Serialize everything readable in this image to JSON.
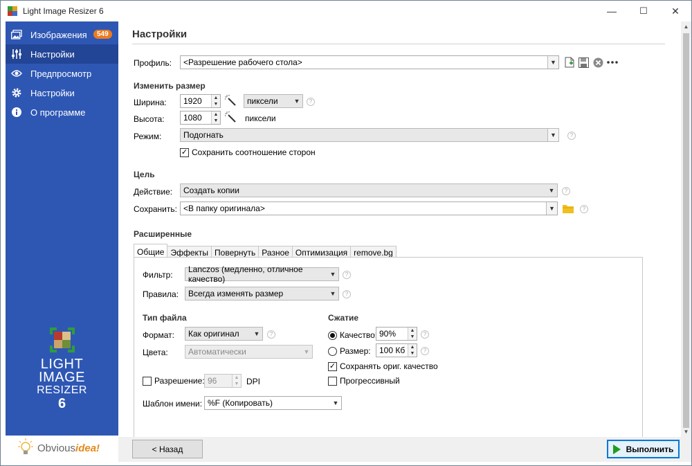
{
  "window": {
    "title": "Light Image Resizer 6",
    "controls": {
      "minimize": "—",
      "maximize": "☐",
      "close": "✕"
    }
  },
  "sidebar": {
    "items": [
      {
        "label": "Изображения",
        "icon": "images-icon",
        "badge": "549"
      },
      {
        "label": "Настройки",
        "icon": "sliders-icon",
        "active": true
      },
      {
        "label": "Предпросмотр",
        "icon": "eye-icon"
      },
      {
        "label": "Настройки",
        "icon": "gear-icon"
      },
      {
        "label": "О программе",
        "icon": "info-icon"
      }
    ],
    "logo": {
      "line1": "LIGHT",
      "line2": "IMAGE",
      "line3": "RESIZER",
      "version": "6"
    },
    "brand": {
      "prefix": "Obvious",
      "accent": "idea!"
    }
  },
  "page": {
    "title": "Настройки"
  },
  "profile": {
    "label": "Профиль:",
    "value": "<Разрешение рабочего стола>"
  },
  "resize": {
    "section": "Изменить размер",
    "width_label": "Ширина:",
    "width_value": "1920",
    "width_unit": "пиксели",
    "height_label": "Высота:",
    "height_value": "1080",
    "height_unit": "пиксели",
    "mode_label": "Режим:",
    "mode_value": "Подогнать",
    "keep_ratio_label": "Сохранить соотношение сторон",
    "keep_ratio_checked": true
  },
  "target": {
    "section": "Цель",
    "action_label": "Действие:",
    "action_value": "Создать копии",
    "save_label": "Сохранить:",
    "save_value": "<В папку оригинала>"
  },
  "advanced": {
    "section": "Расширенные",
    "tabs": [
      "Общие",
      "Эффекты",
      "Повернуть",
      "Разное",
      "Оптимизация",
      "remove.bg"
    ],
    "active_tab": "Общие",
    "filter_label": "Фильтр:",
    "filter_value": "Lanczos  (медленно, отличное качество)",
    "rules_label": "Правила:",
    "rules_value": "Всегда изменять размер",
    "filetype": {
      "section": "Тип файла",
      "format_label": "Формат:",
      "format_value": "Как оригинал",
      "colors_label": "Цвета:",
      "colors_value": "Автоматически"
    },
    "resolution": {
      "label": "Разрешение:",
      "value": "96",
      "unit": "DPI",
      "checked": false
    },
    "compression": {
      "section": "Сжатие",
      "quality_label": "Качество:",
      "quality_value": "90%",
      "quality_selected": true,
      "size_label": "Размер:",
      "size_value": "100 Кб",
      "keep_quality_label": "Сохранять ориг. качество",
      "keep_quality_checked": true,
      "progressive_label": "Прогрессивный",
      "progressive_checked": false
    },
    "name_template": {
      "label": "Шаблон имени:",
      "value": "%F (Копировать)"
    }
  },
  "footer": {
    "back_label": "< Назад",
    "run_label": "Выполнить"
  },
  "colors": {
    "sidebar": "#2e57b4",
    "sidebar_active": "#234596",
    "badge": "#ee7a1f",
    "run_icon": "#1f9d1f"
  }
}
